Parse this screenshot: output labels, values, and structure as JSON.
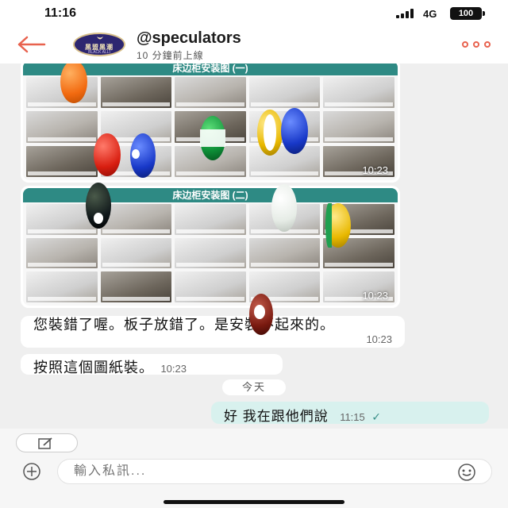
{
  "status_bar": {
    "time": "11:16",
    "network": "4G",
    "battery": "100"
  },
  "header": {
    "account_name": "@speculators",
    "online_status": "10 分鐘前上線",
    "avatar_text": "黑盟黑潮",
    "avatar_subtext": "BLACK ALLI",
    "icons": [
      "back-arrow-icon",
      "more-dots-icon"
    ],
    "accent_color": "#e8624e"
  },
  "messages": {
    "image_1": {
      "title": "床边柜安装图 (一)",
      "time": "10:23"
    },
    "image_2": {
      "title": "床边柜安装图 (二)",
      "time": "10:23"
    },
    "text_1": {
      "text": "您裝錯了喔。板子放錯了。是安裝不起來的。",
      "time": "10:23"
    },
    "text_2": {
      "text": "按照這個圖紙裝。",
      "time": "10:23"
    },
    "date_divider": "今天",
    "outgoing": {
      "text": "好 我在跟他們說",
      "time": "11:15",
      "status_icon": "checkmark-icon"
    }
  },
  "input_bar": {
    "placeholder": "輸入私訊...",
    "icons": [
      "compose-icon",
      "add-icon",
      "emoji-icon"
    ]
  },
  "colors": {
    "diagram_header": "#2e8a84",
    "outgoing_bubble": "#d8f1ee",
    "chat_background": "#efefef"
  }
}
